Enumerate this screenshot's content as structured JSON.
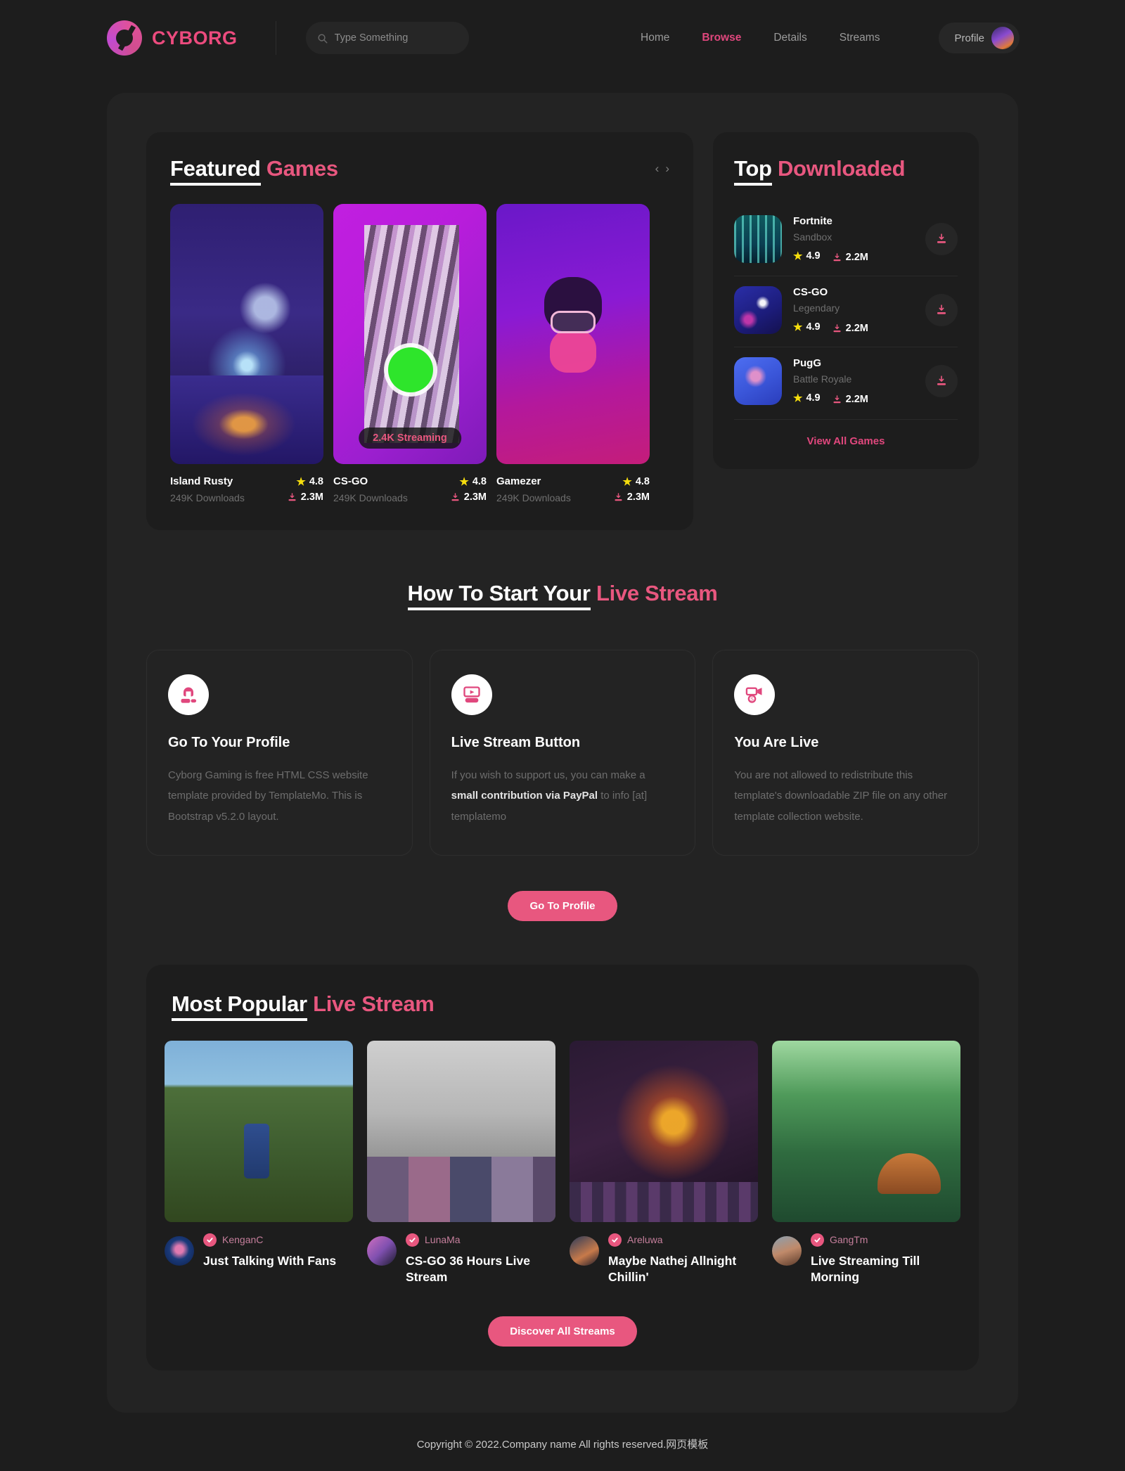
{
  "header": {
    "brand": "CYBORG",
    "search": {
      "placeholder": "Type Something",
      "value": ""
    },
    "nav": [
      {
        "label": "Home",
        "active": false
      },
      {
        "label": "Browse",
        "active": true
      },
      {
        "label": "Details",
        "active": false
      },
      {
        "label": "Streams",
        "active": false
      }
    ],
    "profile_label": "Profile"
  },
  "featured": {
    "title_underlined": "Featured",
    "title_accent": "Games",
    "prev": "‹",
    "next": "›",
    "cards": [
      {
        "name": "Island Rusty",
        "downloads": "249K Downloads",
        "rating": "4.8",
        "installs": "2.3M",
        "badge": ""
      },
      {
        "name": "CS-GO",
        "downloads": "249K Downloads",
        "rating": "4.8",
        "installs": "2.3M",
        "badge": "2.4K Streaming"
      },
      {
        "name": "Gamezer",
        "downloads": "249K Downloads",
        "rating": "4.8",
        "installs": "2.3M",
        "badge": ""
      }
    ]
  },
  "top_downloaded": {
    "title_underlined": "Top",
    "title_accent": "Downloaded",
    "items": [
      {
        "name": "Fortnite",
        "category": "Sandbox",
        "rating": "4.9",
        "installs": "2.2M"
      },
      {
        "name": "CS-GO",
        "category": "Legendary",
        "rating": "4.9",
        "installs": "2.2M"
      },
      {
        "name": "PugG",
        "category": "Battle Royale",
        "rating": "4.9",
        "installs": "2.2M"
      }
    ],
    "view_all": "View All Games"
  },
  "howto": {
    "title_underlined": "How To Start Your",
    "title_accent": "Live Stream",
    "cards": [
      {
        "icon": "gamer-headset-icon",
        "heading": "Go To Your Profile",
        "text_a": "Cyborg Gaming is free HTML CSS website template provided by TemplateMo. This is Bootstrap v5.2.0 layout.",
        "text_b": "",
        "text_c": ""
      },
      {
        "icon": "stream-console-icon",
        "heading": "Live Stream Button",
        "text_a": "If you wish to support us, you can make a ",
        "text_b": "small contribution via PayPal",
        "text_c": " to info [at] templatemo"
      },
      {
        "icon": "video-money-icon",
        "heading": "You Are Live",
        "text_a": "You are not allowed to redistribute this template's downloadable ZIP file on any other template collection website.",
        "text_b": "",
        "text_c": ""
      }
    ],
    "button": "Go To Profile"
  },
  "popular": {
    "title_underlined": "Most Popular",
    "title_accent": "Live Stream",
    "streams": [
      {
        "streamer": "KenganC",
        "title": "Just Talking With Fans"
      },
      {
        "streamer": "LunaMa",
        "title": "CS-GO 36 Hours Live Stream"
      },
      {
        "streamer": "Areluwa",
        "title": "Maybe Nathej Allnight Chillin'"
      },
      {
        "streamer": "GangTm",
        "title": "Live Streaming Till Morning"
      }
    ],
    "button": "Discover All Streams"
  },
  "footer": {
    "copyright": "Copyright © 2022.Company name All rights reserved.网页模板"
  },
  "colors": {
    "accent_pink": "#e8577f",
    "nav_active": "#e0477d",
    "star_yellow": "#f5dd0d",
    "page_bg": "#1d1d1d",
    "panel_bg": "#232323"
  }
}
